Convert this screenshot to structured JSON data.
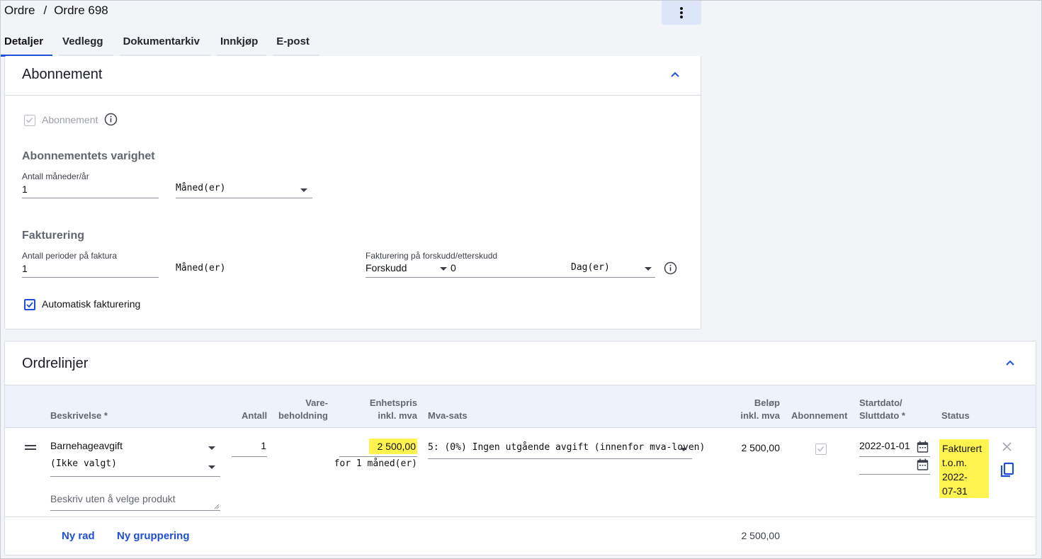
{
  "breadcrumb": {
    "parent": "Ordre",
    "separator": "/",
    "current": "Ordre 698"
  },
  "tabs": [
    {
      "label": "Detaljer",
      "active": true
    },
    {
      "label": "Vedlegg",
      "active": false
    },
    {
      "label": "Dokumentarkiv",
      "active": false
    },
    {
      "label": "Innkjøp",
      "active": false
    },
    {
      "label": "E-post",
      "active": false
    }
  ],
  "subscription": {
    "title": "Abonnement",
    "checkbox_label": "Abonnement",
    "checkbox_checked": true,
    "checkbox_disabled": true,
    "duration": {
      "heading": "Abonnementets varighet",
      "count_label": "Antall måneder/år",
      "count_value": "1",
      "unit_value": "Måned(er)"
    },
    "billing": {
      "heading": "Fakturering",
      "periods_label": "Antall perioder på faktura",
      "periods_value": "1",
      "periods_unit": "Måned(er)",
      "advance_label": "Fakturering på forskudd/etterskudd",
      "advance_value": "Forskudd",
      "offset_value": "0",
      "offset_unit": "Dag(er)",
      "auto_label": "Automatisk fakturering",
      "auto_checked": true
    }
  },
  "order_lines": {
    "title": "Ordrelinjer",
    "headers": {
      "description": "Beskrivelse *",
      "quantity": "Antall",
      "stock_1": "Vare-",
      "stock_2": "beholdning",
      "unit_price_1": "Enhetspris",
      "unit_price_2": "inkl. mva",
      "vat": "Mva-sats",
      "amount_1": "Beløp",
      "amount_2": "inkl. mva",
      "subscription": "Abonnement",
      "dates_1": "Startdato/",
      "dates_2": "Sluttdato *",
      "status": "Status"
    },
    "rows": [
      {
        "product": "Barnehageavgift",
        "variant": "(Ikke valgt)",
        "description_placeholder": "Beskriv uten å velge produkt",
        "quantity": "1",
        "unit_price": "2 500,00",
        "price_period": "for 1 måned(er)",
        "vat": "5: (0%) Ingen utgående avgift (innenfor mva-loven)",
        "amount": "2 500,00",
        "subscription_checked": true,
        "start_date": "2022-01-01",
        "end_date": "",
        "status_lines": [
          "Fakturert",
          "t.o.m.",
          "2022-",
          "07-31"
        ]
      }
    ],
    "footer": {
      "new_row": "Ny rad",
      "new_group": "Ny gruppering",
      "total": "2 500,00"
    }
  },
  "colors": {
    "accent": "#1f4fd8",
    "highlight": "#fff34f",
    "tab_active": "#1f4fd8",
    "header_bg": "#f2f4f8"
  }
}
